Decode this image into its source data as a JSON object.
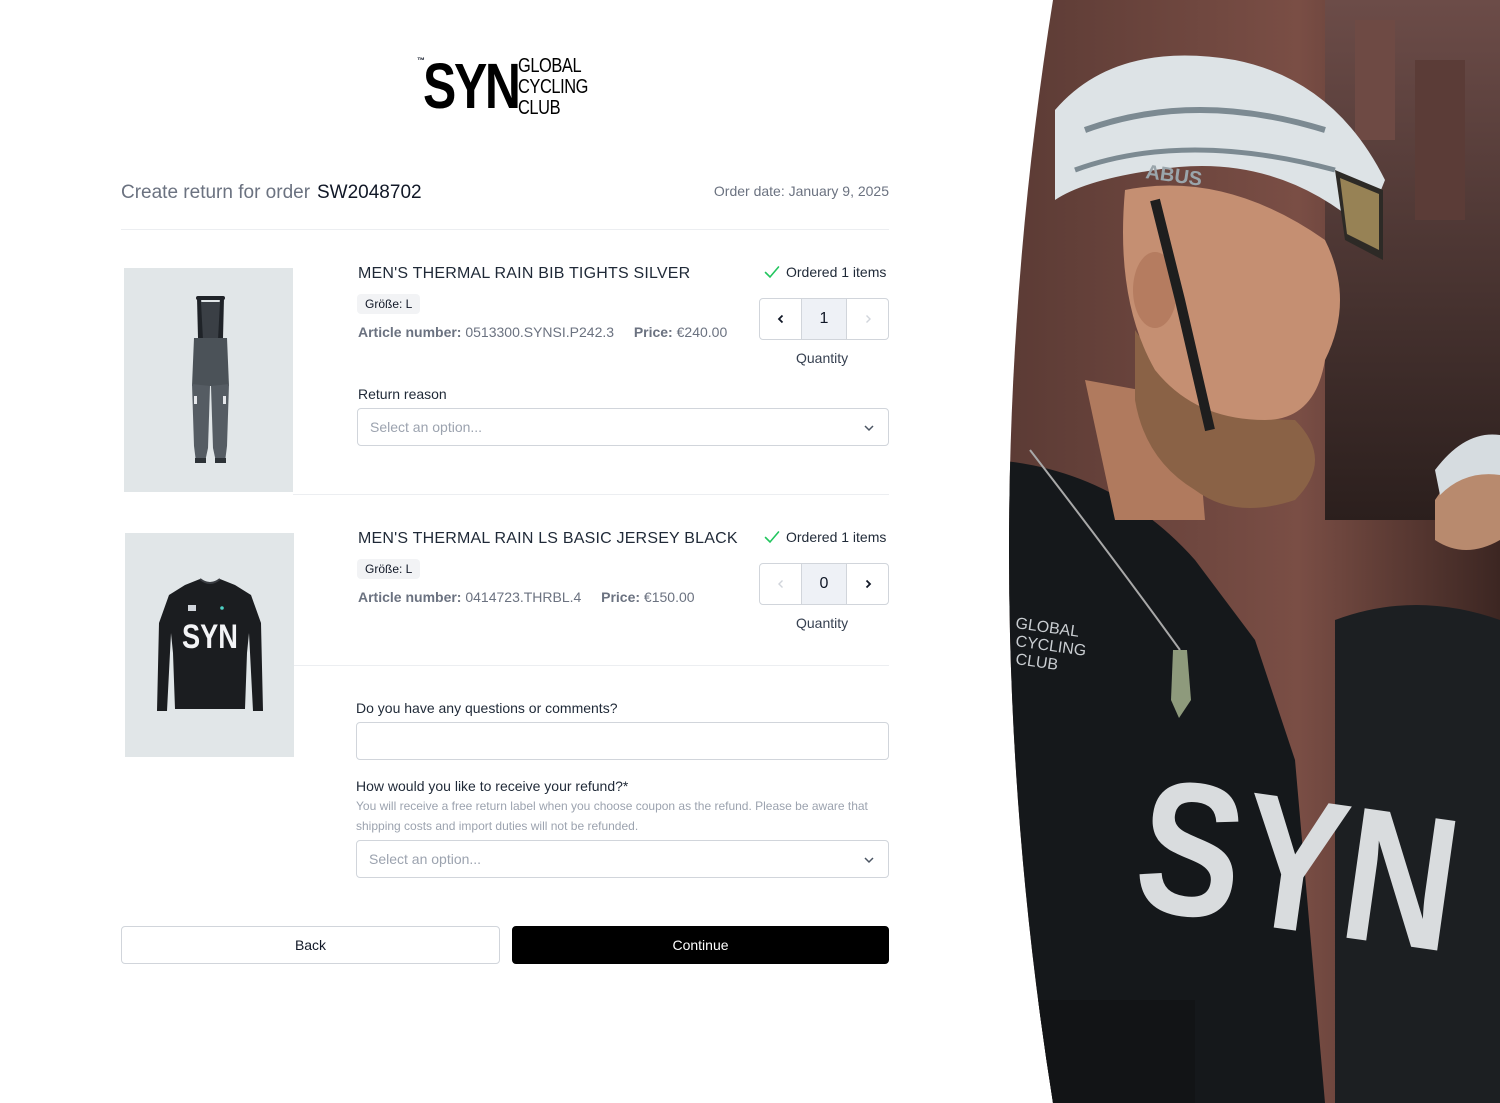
{
  "brand": {
    "logo_tm": "™",
    "logo_main": "SYN",
    "logo_line1": "GLOBAL",
    "logo_line2": "CYCLING",
    "logo_line3": "CLUB"
  },
  "header": {
    "prefix": "Create return for order",
    "order_number": "SW2048702",
    "order_date": "Order date: January 9, 2025"
  },
  "items": [
    {
      "title": "MEN'S THERMAL RAIN BIB TIGHTS SILVER",
      "size": "Größe: L",
      "article_label": "Article number:",
      "article_value": "0513300.SYNSI.P242.3",
      "price_label": "Price:",
      "price_value": "€240.00",
      "ordered": "Ordered 1 items",
      "quantity": "1",
      "quantity_label": "Quantity",
      "return_reason_label": "Return reason",
      "return_reason_placeholder": "Select an option..."
    },
    {
      "title": "MEN'S THERMAL RAIN LS BASIC JERSEY BLACK",
      "size": "Größe: L",
      "article_label": "Article number:",
      "article_value": "0414723.THRBL.4",
      "price_label": "Price:",
      "price_value": "€150.00",
      "ordered": "Ordered 1 items",
      "quantity": "0",
      "quantity_label": "Quantity",
      "jersey_print": "SYN"
    }
  ],
  "comments": {
    "label": "Do you have any questions or comments?",
    "value": ""
  },
  "refund": {
    "label": "How would you like to receive your refund?*",
    "helper": "You will receive a free return label when you choose coupon as the refund. Please be aware that shipping costs and import duties will not be refunded.",
    "placeholder": "Select an option..."
  },
  "actions": {
    "back": "Back",
    "continue": "Continue"
  },
  "photo": {
    "shirt_print_small_1": "GLOBAL",
    "shirt_print_small_2": "CYCLING",
    "shirt_print_small_3": "CLUB",
    "shirt_print_big": "SYN",
    "helmet_brand": "ABUS"
  },
  "colors": {
    "accent_check": "#22c55e",
    "continue_bg": "#000000",
    "image_bg": "#e1e6e8"
  }
}
